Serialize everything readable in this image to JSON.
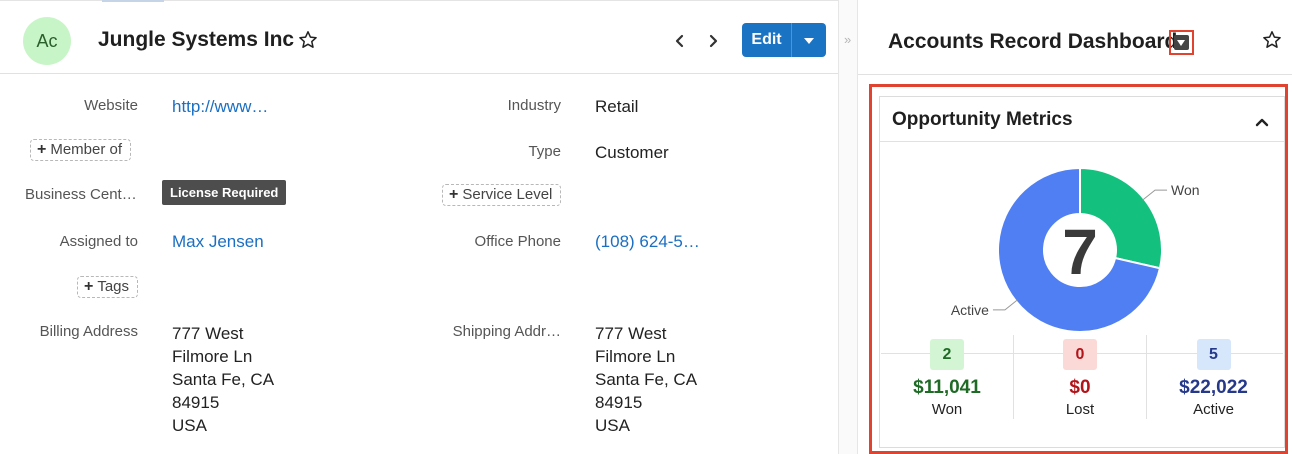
{
  "record": {
    "avatar_initials": "Ac",
    "title": "Jungle Systems Inc",
    "edit_label": "Edit",
    "fields": {
      "website_label": "Website",
      "website_value": "http://www…",
      "member_of_label": "Member of",
      "business_center_label": "Business Cent…",
      "license_badge": "License Required",
      "assigned_to_label": "Assigned to",
      "assigned_to_value": "Max Jensen",
      "tags_label": "Tags",
      "billing_address_label": "Billing Address",
      "billing_address_lines": [
        "777 West",
        "Filmore Ln",
        "Santa Fe, CA",
        "84915",
        "USA"
      ],
      "industry_label": "Industry",
      "industry_value": "Retail",
      "type_label": "Type",
      "type_value": "Customer",
      "service_level_label": "Service Level",
      "office_phone_label": "Office Phone",
      "office_phone_value": "(108) 624-5…",
      "shipping_address_label": "Shipping Addr…",
      "shipping_address_lines": [
        "777 West",
        "Filmore Ln",
        "Santa Fe, CA",
        "84915",
        "USA"
      ]
    }
  },
  "dashboard": {
    "title": "Accounts Record Dashboard",
    "dashlet": {
      "title": "Opportunity Metrics",
      "total": "7",
      "metrics": [
        {
          "key": "won",
          "count": 2,
          "count_text": "2",
          "amount": "$11,041",
          "label": "Won",
          "badge_bg": "#d4f5d4",
          "badge_fg": "#1f6b26",
          "amount_color": "#1f6b26"
        },
        {
          "key": "lost",
          "count": 0,
          "count_text": "0",
          "amount": "$0",
          "label": "Lost",
          "badge_bg": "#fbd9d6",
          "badge_fg": "#b3141a",
          "amount_color": "#b3141a"
        },
        {
          "key": "active",
          "count": 5,
          "count_text": "5",
          "amount": "$22,022",
          "label": "Active",
          "badge_bg": "#d6e6fb",
          "badge_fg": "#26388a",
          "amount_color": "#26388a"
        }
      ]
    }
  },
  "chart_data": {
    "type": "pie",
    "categories": [
      "Won",
      "Active"
    ],
    "values": [
      2,
      5
    ],
    "colors": [
      "#13c07e",
      "#4f7ff3"
    ],
    "center_label": "7"
  },
  "colors": {
    "accent": "#1b73c4",
    "link": "#1a6fc2",
    "highlight": "#e0432f"
  },
  "icons": [
    "star-icon",
    "chevron-left-icon",
    "chevron-right-icon",
    "caret-down-icon",
    "double-chevron-right-icon",
    "chevron-up-icon",
    "plus-icon"
  ]
}
